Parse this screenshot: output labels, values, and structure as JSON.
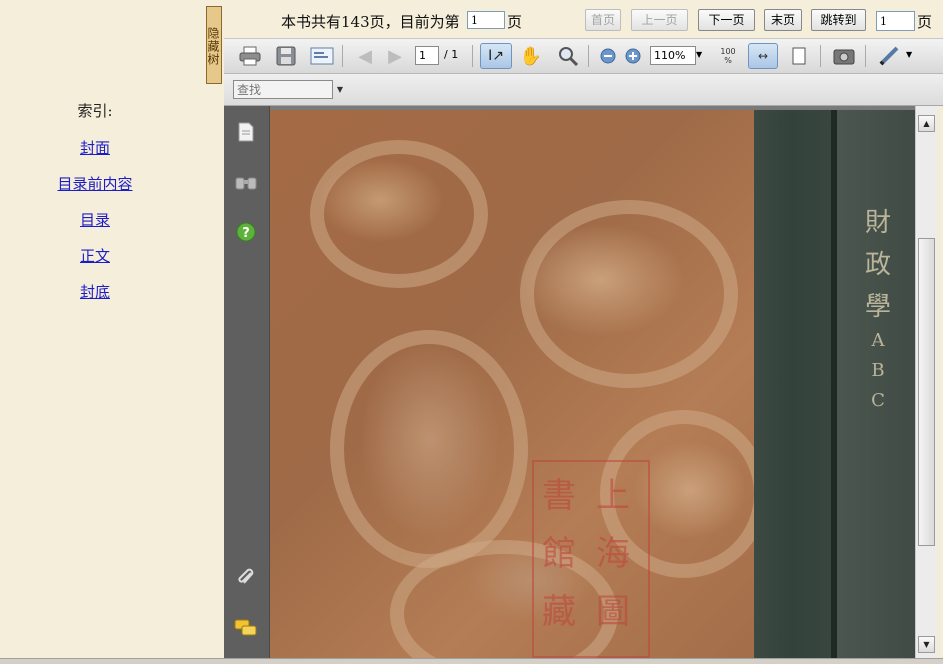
{
  "sidebar": {
    "title": "索引:",
    "hide_tab_label": "隐藏树",
    "links": [
      "封面",
      "目录前内容",
      "目录",
      "正文",
      "封底"
    ]
  },
  "nav": {
    "total_text": "本书共有143页，目前为第",
    "current_page": "1",
    "page_suffix": "页",
    "first_btn": "首页",
    "prev_btn": "上一页",
    "next_btn": "下一页",
    "last_btn": "末页",
    "jump_btn": "跳转到",
    "jump_value": "1",
    "jump_suffix": "页"
  },
  "toolbar": {
    "page_value": "1",
    "page_total": "/ 1",
    "zoom_value": "110%",
    "icons": [
      "print-icon",
      "save-icon",
      "email-icon",
      "prev-page-icon",
      "next-page-icon",
      "select-text-icon",
      "hand-icon",
      "zoom-tool-icon",
      "zoom-out-icon",
      "zoom-in-icon",
      "fit-page-icon",
      "fit-width-icon",
      "single-page-icon",
      "snapshot-icon",
      "pen-icon"
    ]
  },
  "findbar": {
    "placeholder": "查找"
  },
  "document": {
    "spine_text": [
      "財",
      "政",
      "學",
      "A",
      "B",
      "C"
    ]
  },
  "colors": {
    "panel_bg": "#f4eedb",
    "link": "#1d1dc8",
    "active_tool": "#a9c6e6",
    "spine": "#3d4a44",
    "cover": "#a46a45"
  }
}
